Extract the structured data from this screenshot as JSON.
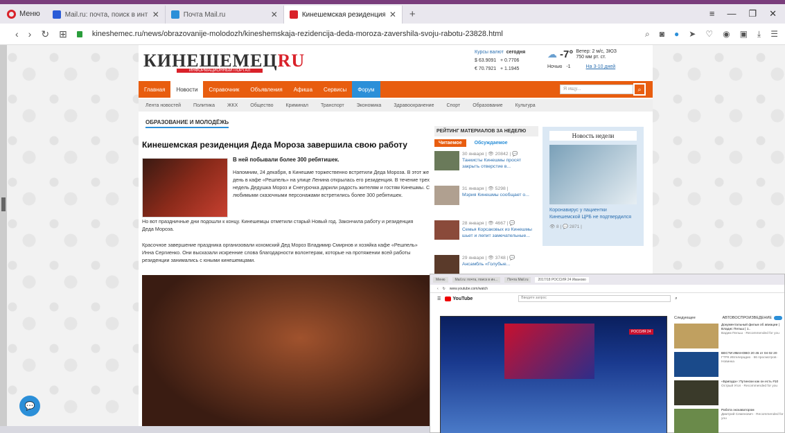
{
  "browser": {
    "menu_label": "Меню",
    "tabs": [
      {
        "title": "Mail.ru: почта, поиск в инт",
        "favicon_color": "#2a5bd7"
      },
      {
        "title": "Почта Mail.ru",
        "favicon_color": "#2b8fd8"
      },
      {
        "title": "Кинешемская резиденция",
        "favicon_color": "#d9222a"
      }
    ],
    "new_tab": "+",
    "url": "kineshemec.ru/news/obrazovanije-molodozh/kineshemskaja-rezidencija-deda-moroza-zavershila-svoju-rabotu-23828.html"
  },
  "site": {
    "logo_main": "КИНЕШЕМЕЦ",
    "logo_ru": "RU",
    "logo_sub": "ИНФОРМАЦИОННЫЙ ПОРТАЛ",
    "rates": {
      "label": "Курсы валют",
      "today": "сегодня",
      "usd": "63.9091",
      "usd_delta": "+ 0.7706",
      "eur": "70.7921",
      "eur_delta": "+ 1.1945"
    },
    "weather": {
      "temp": "-7°",
      "details_1": "Ветер: 2 м/с, ЗЮЗ",
      "details_2": "750 мм рт. ст.",
      "night_label": "Ночью",
      "night_temp": "-1",
      "link": "На 3-10 дней"
    },
    "menu": [
      "Главная",
      "Новости",
      "Справочник",
      "Объявления",
      "Афиша",
      "Сервисы",
      "Форум"
    ],
    "search_placeholder": "Я ищу...",
    "submenu": [
      "Лента новостей",
      "Политика",
      "ЖКХ",
      "Общество",
      "Криминал",
      "Транспорт",
      "Экономика",
      "Здравоохранение",
      "Спорт",
      "Образование",
      "Культура"
    ]
  },
  "article": {
    "section": "ОБРАЗОВАНИЕ И МОЛОДЁЖЬ",
    "title": "Кинешемская резиденция Деда Мороза завершила свою работу",
    "lead": "В ней побывали более 300 ребятишек.",
    "p1": "Напомним, 24 декабря, в Кинешме торжественно встретили Деда Мороза. В этот же день в кафе «Решпель» на улице Ленина открылась его резиденция. В течение трех недель Дедушка Мороз и Снегурочка дарили радость жителям и гостям Кинешмы. С любимыми сказочными персонажами встретились более 300 ребятишек.",
    "p2": "Но вот праздничные дни подошли к концу. Кинешемцы отметили старый Новый год. Закончила работу и резиденция Деда Мороза.",
    "p3": "Красочное завершение праздника организовали кохомский Дед Мороз Владимир Смирнов и хозяйка кафе «Решпель» Инна Сергиенко. Они высказали искренние слова благодарности волонтерам, которые на протяжении всей работы резиденции занимались с юными кинешемцами."
  },
  "rating": {
    "header": "РЕЙТИНГ МАТЕРИАЛОВ ЗА НЕДЕЛЮ",
    "tab_read": "Читаемое",
    "tab_discussed": "Обсуждаемое",
    "items": [
      {
        "meta": "30 января | 👁 20842 | 💬",
        "text": "Танкисты Кинешмы просят закрыть отверстие в..."
      },
      {
        "meta": "31 января | 👁 5298 |",
        "text": "Мэрия Кинешмы сообщает о..."
      },
      {
        "meta": "28 января | 👁 4667 | 💬",
        "text": "Семья Корсаковых из Кинешмы шьет и лепит замечательные..."
      },
      {
        "meta": "29 января | 👁 3748 | 💬",
        "text": "Ансамбль «Голубые..."
      }
    ]
  },
  "news_week": {
    "title": "Новость недели",
    "text": "Коронавирус у пациентки Кинешемской ЦРБ не подтвердился",
    "meta": "👁 8 | 💬 2871 |"
  },
  "youtube": {
    "tabs": [
      "Меню",
      "Mail.ru: почта, поиск в ин...",
      "Почта Mail.ru",
      "2017/18 РОССИЯ 24 Иваново"
    ],
    "url": "www.youtube.com/watch",
    "search_placeholder": "Введите запрос",
    "logo": "YouTube",
    "channel_badge": "РОССИЯ 24",
    "next_label": "Следующее",
    "autoplay_label": "АВТОВОСПРОИЗВЕДЕНИЕ",
    "side": [
      {
        "title": "Документальный фильм об авиации | Владис Пельш | 1..",
        "meta": "Вадим Пельш · Recommended for you",
        "duration": "51:31"
      },
      {
        "title": "ВЕСТИ ИВАНОВО 20 45 от 04 02 20",
        "meta": "ГТРК Ивтелерадио · 66 просмотров · Новинка",
        "duration": "14:32"
      },
      {
        "title": "«Бригада»: Путински как он есть #10",
        "meta": "Острый Угол · Recommended for you",
        "duration": "16:31"
      },
      {
        "title": "Работа экскаватором",
        "meta": "Дмитрий Семенович · Recommended for you",
        "duration": ""
      }
    ]
  }
}
